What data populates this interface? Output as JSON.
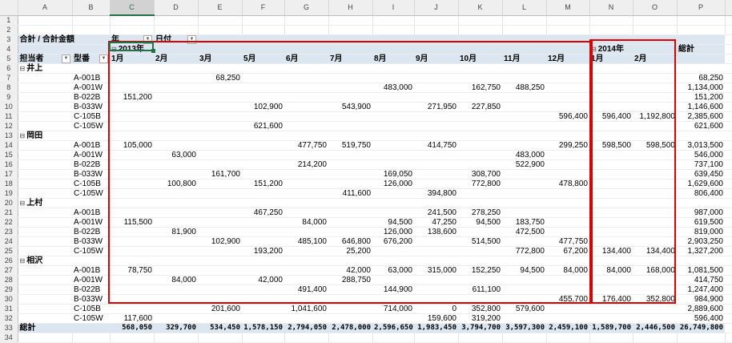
{
  "columns": [
    "A",
    "B",
    "C",
    "D",
    "E",
    "F",
    "G",
    "H",
    "I",
    "J",
    "K",
    "L",
    "M",
    "N",
    "O",
    "P"
  ],
  "pivot": {
    "title": "合計 / 合計金額",
    "col_field_year": "年",
    "col_field_date": "日付",
    "row_field_person": "担当者",
    "row_field_model": "型番",
    "years": [
      {
        "label": "2013年",
        "span": 11
      },
      {
        "label": "2014年",
        "span": 2
      }
    ],
    "months": [
      "1月",
      "2月",
      "3月",
      "5月",
      "6月",
      "7月",
      "8月",
      "9月",
      "10月",
      "11月",
      "12月",
      "1月",
      "2月"
    ],
    "grand_total_label": "総計",
    "groups": [
      {
        "name": "井上",
        "rows": [
          {
            "model": "A-001B",
            "values": [
              "",
              "",
              "68,250",
              "",
              "",
              "",
              "",
              "",
              "",
              "",
              "",
              "",
              ""
            ],
            "total": "68,250"
          },
          {
            "model": "A-001W",
            "values": [
              "",
              "",
              "",
              "",
              "",
              "",
              "483,000",
              "",
              "162,750",
              "488,250",
              "",
              "",
              ""
            ],
            "total": "1,134,000"
          },
          {
            "model": "B-022B",
            "values": [
              "151,200",
              "",
              "",
              "",
              "",
              "",
              "",
              "",
              "",
              "",
              "",
              "",
              ""
            ],
            "total": "151,200"
          },
          {
            "model": "B-033W",
            "values": [
              "",
              "",
              "",
              "102,900",
              "",
              "543,900",
              "",
              "271,950",
              "227,850",
              "",
              "",
              "",
              ""
            ],
            "total": "1,146,600"
          },
          {
            "model": "C-105B",
            "values": [
              "",
              "",
              "",
              "",
              "",
              "",
              "",
              "",
              "",
              "",
              "596,400",
              "596,400",
              "1,192,800"
            ],
            "total": "2,385,600"
          },
          {
            "model": "C-105W",
            "values": [
              "",
              "",
              "",
              "621,600",
              "",
              "",
              "",
              "",
              "",
              "",
              "",
              "",
              ""
            ],
            "total": "621,600"
          }
        ]
      },
      {
        "name": "岡田",
        "rows": [
          {
            "model": "A-001B",
            "values": [
              "105,000",
              "",
              "",
              "",
              "477,750",
              "519,750",
              "",
              "414,750",
              "",
              "",
              "299,250",
              "598,500",
              "598,500"
            ],
            "total": "3,013,500"
          },
          {
            "model": "A-001W",
            "values": [
              "",
              "63,000",
              "",
              "",
              "",
              "",
              "",
              "",
              "",
              "483,000",
              "",
              "",
              ""
            ],
            "total": "546,000"
          },
          {
            "model": "B-022B",
            "values": [
              "",
              "",
              "",
              "",
              "214,200",
              "",
              "",
              "",
              "",
              "522,900",
              "",
              "",
              ""
            ],
            "total": "737,100"
          },
          {
            "model": "B-033W",
            "values": [
              "",
              "",
              "161,700",
              "",
              "",
              "",
              "169,050",
              "",
              "308,700",
              "",
              "",
              "",
              ""
            ],
            "total": "639,450"
          },
          {
            "model": "C-105B",
            "values": [
              "",
              "100,800",
              "",
              "151,200",
              "",
              "",
              "126,000",
              "",
              "772,800",
              "",
              "478,800",
              "",
              ""
            ],
            "total": "1,629,600"
          },
          {
            "model": "C-105W",
            "values": [
              "",
              "",
              "",
              "",
              "",
              "411,600",
              "",
              "394,800",
              "",
              "",
              "",
              "",
              ""
            ],
            "total": "806,400"
          }
        ]
      },
      {
        "name": "上村",
        "rows": [
          {
            "model": "A-001B",
            "values": [
              "",
              "",
              "",
              "467,250",
              "",
              "",
              "",
              "241,500",
              "278,250",
              "",
              "",
              "",
              ""
            ],
            "total": "987,000"
          },
          {
            "model": "A-001W",
            "values": [
              "115,500",
              "",
              "",
              "",
              "84,000",
              "",
              "94,500",
              "47,250",
              "94,500",
              "183,750",
              "",
              "",
              ""
            ],
            "total": "619,500"
          },
          {
            "model": "B-022B",
            "values": [
              "",
              "81,900",
              "",
              "",
              "",
              "",
              "126,000",
              "138,600",
              "",
              "472,500",
              "",
              "",
              ""
            ],
            "total": "819,000"
          },
          {
            "model": "B-033W",
            "values": [
              "",
              "",
              "102,900",
              "",
              "485,100",
              "646,800",
              "676,200",
              "",
              "514,500",
              "",
              "477,750",
              "",
              ""
            ],
            "total": "2,903,250"
          },
          {
            "model": "C-105W",
            "values": [
              "",
              "",
              "",
              "193,200",
              "",
              "25,200",
              "",
              "",
              "",
              "772,800",
              "67,200",
              "134,400",
              "134,400"
            ],
            "total": "1,327,200"
          }
        ]
      },
      {
        "name": "相沢",
        "rows": [
          {
            "model": "A-001B",
            "values": [
              "78,750",
              "",
              "",
              "",
              "",
              "42,000",
              "63,000",
              "315,000",
              "152,250",
              "94,500",
              "84,000",
              "84,000",
              "168,000"
            ],
            "total": "1,081,500"
          },
          {
            "model": "A-001W",
            "values": [
              "",
              "84,000",
              "",
              "42,000",
              "",
              "288,750",
              "",
              "",
              "",
              "",
              "",
              "",
              ""
            ],
            "total": "414,750"
          },
          {
            "model": "B-022B",
            "values": [
              "",
              "",
              "",
              "",
              "491,400",
              "",
              "144,900",
              "",
              "611,100",
              "",
              "",
              "",
              ""
            ],
            "total": "1,247,400"
          },
          {
            "model": "B-033W",
            "values": [
              "",
              "",
              "",
              "",
              "",
              "",
              "",
              "",
              "",
              "",
              "455,700",
              "176,400",
              "352,800"
            ],
            "total": "984,900"
          },
          {
            "model": "C-105B",
            "values": [
              "",
              "",
              "201,600",
              "",
              "1,041,600",
              "",
              "714,000",
              "0",
              "352,800",
              "579,600",
              "",
              "",
              ""
            ],
            "total": "2,889,600"
          },
          {
            "model": "C-105W",
            "values": [
              "117,600",
              "",
              "",
              "",
              "",
              "",
              "",
              "159,600",
              "319,200",
              "",
              "",
              "",
              ""
            ],
            "total": "596,400"
          }
        ]
      }
    ],
    "column_totals": [
      "568,050",
      "329,700",
      "534,450",
      "1,578,150",
      "2,794,050",
      "2,478,000",
      "2,596,650",
      "1,983,450",
      "3,794,700",
      "3,597,300",
      "2,459,100",
      "1,589,700",
      "2,446,500"
    ],
    "grand_total": "26,749,800"
  },
  "colors": {
    "pivot_header": "#dce6f1",
    "highlight_box": "#e00000",
    "selection": "#217346"
  }
}
